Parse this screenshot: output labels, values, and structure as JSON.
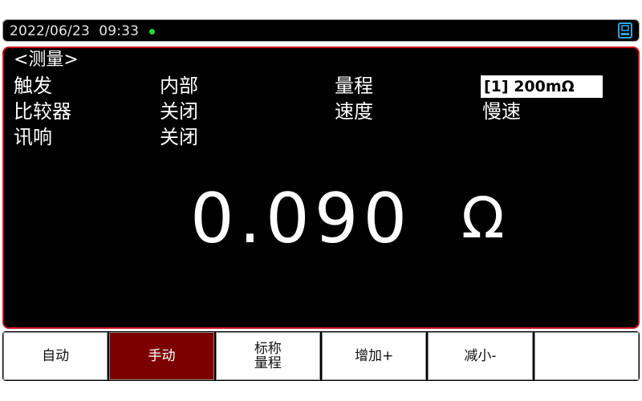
{
  "status": {
    "datetime": "2022/06/23  09:33",
    "indicator_color": "#22dd33",
    "usb_icon": "usb-drive-icon"
  },
  "screen": {
    "title": "<测量>",
    "rows": [
      {
        "label": "触发",
        "value": "内部"
      },
      {
        "label": "比较器",
        "value": "关闭"
      },
      {
        "label": "讯响",
        "value": "关闭"
      }
    ],
    "range_label": "量程",
    "range_value": "[1] 200mΩ",
    "speed_label": "速度",
    "speed_value": "慢速",
    "reading": "0.090",
    "unit": "Ω"
  },
  "softkeys": [
    {
      "label": "自动",
      "active": false
    },
    {
      "label": "手动",
      "active": true
    },
    {
      "line1": "标称",
      "line2": "量程",
      "active": false
    },
    {
      "label": "增加+",
      "active": false
    },
    {
      "label": "减小-",
      "active": false
    },
    {
      "label": "",
      "active": false
    }
  ],
  "colors": {
    "accent": "#c8161d",
    "active_key": "#7d0000",
    "background": "#000000"
  }
}
